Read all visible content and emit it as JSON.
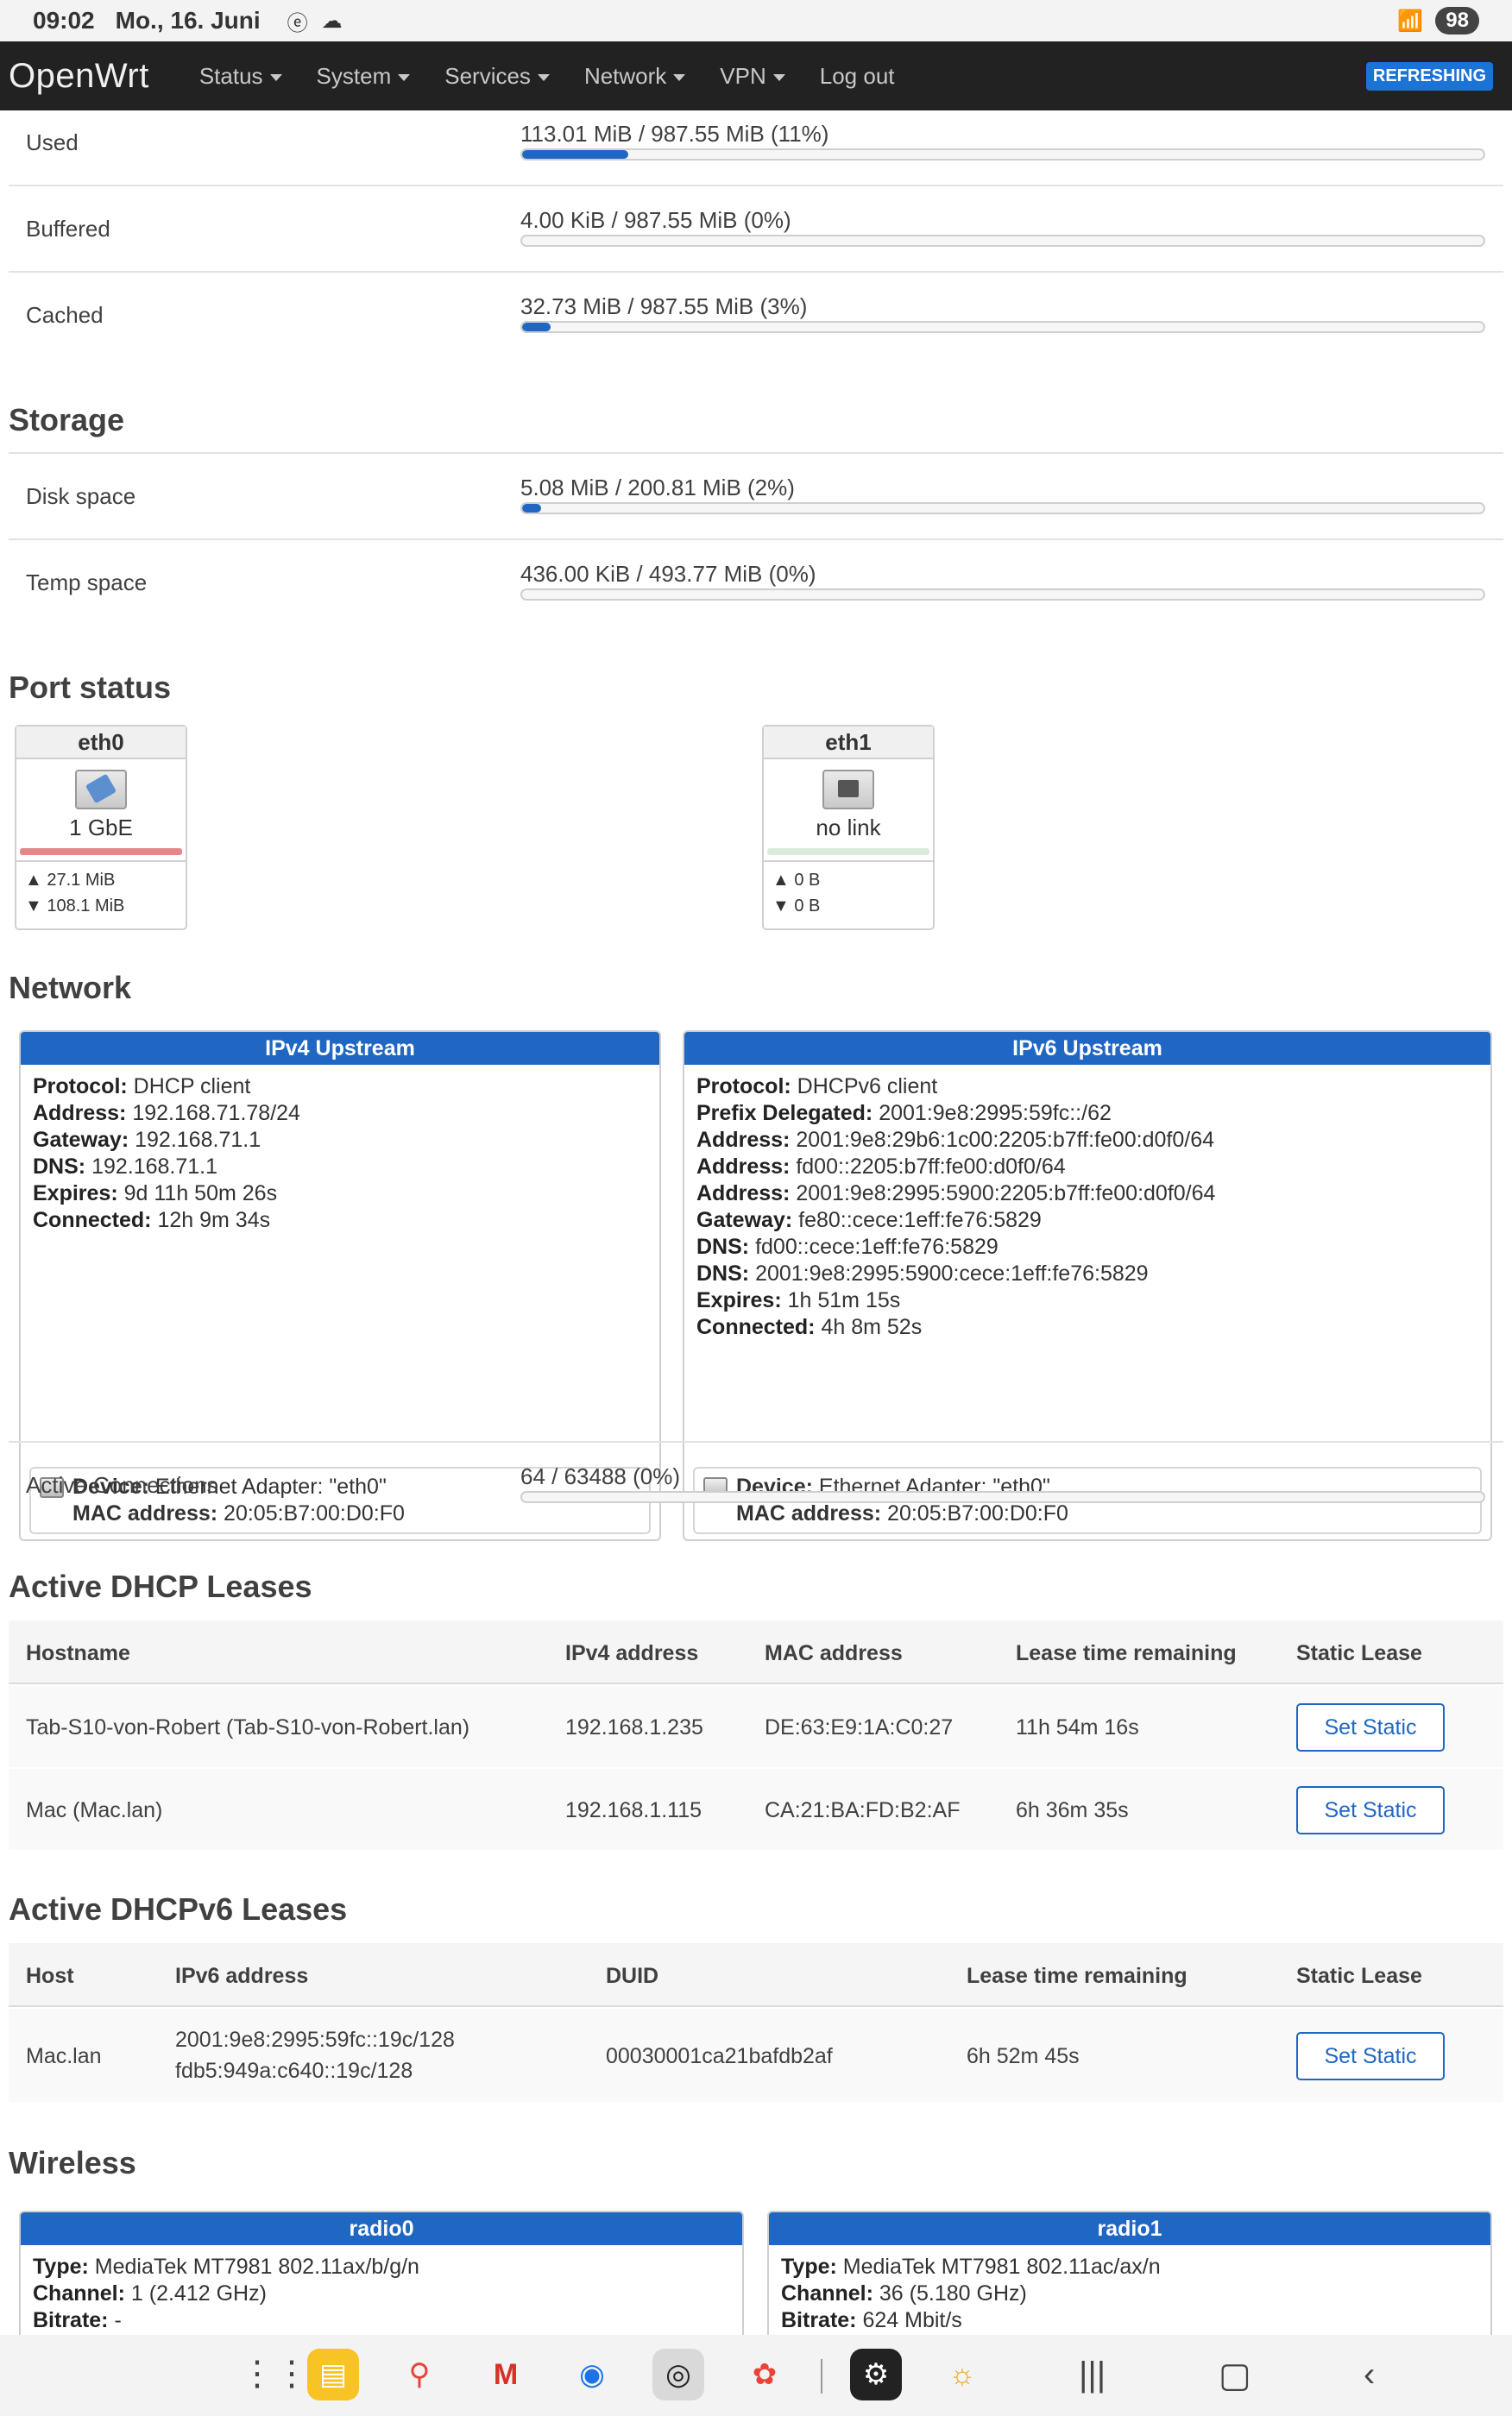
{
  "statusbar": {
    "time": "09:02",
    "date": "Mo., 16. Juni",
    "battery": "98"
  },
  "header": {
    "brand": "OpenWrt",
    "nav": [
      "Status",
      "System",
      "Services",
      "Network",
      "VPN",
      "Log out"
    ],
    "refreshing": "REFRESHING"
  },
  "memory": [
    {
      "label": "Used",
      "value": "113.01 MiB / 987.55 MiB (11%)",
      "fraction": 0.11
    },
    {
      "label": "Buffered",
      "value": "4.00 KiB / 987.55 MiB (0%)",
      "fraction": 0.0
    },
    {
      "label": "Cached",
      "value": "32.73 MiB / 987.55 MiB (3%)",
      "fraction": 0.03
    }
  ],
  "storage": {
    "title": "Storage",
    "rows": [
      {
        "label": "Disk space",
        "value": "5.08 MiB / 200.81 MiB (2%)",
        "fraction": 0.02
      },
      {
        "label": "Temp space",
        "value": "436.00 KiB / 493.77 MiB (0%)",
        "fraction": 0.0
      }
    ]
  },
  "ports": {
    "title": "Port status",
    "items": [
      {
        "name": "eth0",
        "speed": "1 GbE",
        "tx": "▲ 27.1 MiB",
        "rx": "▼ 108.1 MiB",
        "line_color": "#e6868a"
      },
      {
        "name": "eth1",
        "speed": "no link",
        "tx": "▲ 0 B",
        "rx": "▼ 0 B",
        "line_color": "#d9ecd9"
      }
    ]
  },
  "network": {
    "title": "Network",
    "ipv4": {
      "title": "IPv4 Upstream",
      "lines": [
        {
          "k": "Protocol:",
          "v": "DHCP client"
        },
        {
          "k": "Address:",
          "v": "192.168.71.78/24"
        },
        {
          "k": "Gateway:",
          "v": "192.168.71.1"
        },
        {
          "k": "DNS:",
          "v": "192.168.71.1"
        },
        {
          "k": "Expires:",
          "v": "9d 11h 50m 26s"
        },
        {
          "k": "Connected:",
          "v": "12h 9m 34s"
        }
      ],
      "device_k": "Device:",
      "device_v": "Ethernet Adapter: \"eth0\"",
      "mac_k": "MAC address:",
      "mac_v": "20:05:B7:00:D0:F0"
    },
    "ipv6": {
      "title": "IPv6 Upstream",
      "lines": [
        {
          "k": "Protocol:",
          "v": "DHCPv6 client"
        },
        {
          "k": "Prefix Delegated:",
          "v": "2001:9e8:2995:59fc::/62"
        },
        {
          "k": "Address:",
          "v": "2001:9e8:29b6:1c00:2205:b7ff:fe00:d0f0/64"
        },
        {
          "k": "Address:",
          "v": "fd00::2205:b7ff:fe00:d0f0/64"
        },
        {
          "k": "Address:",
          "v": "2001:9e8:2995:5900:2205:b7ff:fe00:d0f0/64"
        },
        {
          "k": "Gateway:",
          "v": "fe80::cece:1eff:fe76:5829"
        },
        {
          "k": "DNS:",
          "v": "fd00::cece:1eff:fe76:5829"
        },
        {
          "k": "DNS:",
          "v": "2001:9e8:2995:5900:cece:1eff:fe76:5829"
        },
        {
          "k": "Expires:",
          "v": "1h 51m 15s"
        },
        {
          "k": "Connected:",
          "v": "4h 8m 52s"
        }
      ],
      "device_k": "Device:",
      "device_v": "Ethernet Adapter: \"eth0\"",
      "mac_k": "MAC address:",
      "mac_v": "20:05:B7:00:D0:F0"
    },
    "active_connections": {
      "label": "Active Connections",
      "value": "64 / 63488 (0%)",
      "fraction": 0.0
    }
  },
  "dhcp": {
    "title": "Active DHCP Leases",
    "headers": [
      "Hostname",
      "IPv4 address",
      "MAC address",
      "Lease time remaining",
      "Static Lease"
    ],
    "rows": [
      {
        "host": "Tab-S10-von-Robert (Tab-S10-von-Robert.lan)",
        "ip": "192.168.1.235",
        "mac": "DE:63:E9:1A:C0:27",
        "lease": "11h 54m 16s",
        "button": "Set Static"
      },
      {
        "host": "Mac (Mac.lan)",
        "ip": "192.168.1.115",
        "mac": "CA:21:BA:FD:B2:AF",
        "lease": "6h 36m 35s",
        "button": "Set Static"
      }
    ]
  },
  "dhcp6": {
    "title": "Active DHCPv6 Leases",
    "headers": [
      "Host",
      "IPv6 address",
      "DUID",
      "Lease time remaining",
      "Static Lease"
    ],
    "rows": [
      {
        "host": "Mac.lan",
        "ip1": "2001:9e8:2995:59fc::19c/128",
        "ip2": "fdb5:949a:c640::19c/128",
        "duid": "00030001ca21bafdb2af",
        "lease": "6h 52m 45s",
        "button": "Set Static"
      }
    ]
  },
  "wireless": {
    "title": "Wireless",
    "radios": [
      {
        "title": "radio0",
        "lines": [
          {
            "k": "Type:",
            "v": "MediaTek MT7981 802.11ax/b/g/n"
          },
          {
            "k": "Channel:",
            "v": "1 (2.412 GHz)"
          },
          {
            "k": "Bitrate:",
            "v": "-"
          }
        ]
      },
      {
        "title": "radio1",
        "lines": [
          {
            "k": "Type:",
            "v": "MediaTek MT7981 802.11ac/ax/n"
          },
          {
            "k": "Channel:",
            "v": "36 (5.180 GHz)"
          },
          {
            "k": "Bitrate:",
            "v": "624 Mbit/s"
          }
        ]
      }
    ]
  }
}
